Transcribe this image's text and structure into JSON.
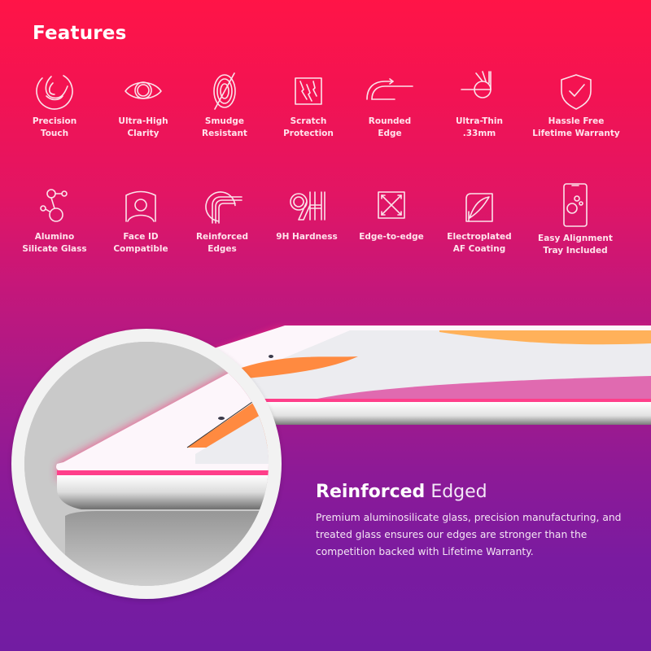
{
  "title": "Features",
  "features": [
    {
      "icon": "precision-touch-icon",
      "label": "Precision\nTouch"
    },
    {
      "icon": "eye-icon",
      "label": "Ultra-High\nClarity"
    },
    {
      "icon": "fingerprint-icon",
      "label": "Smudge\nResistant"
    },
    {
      "icon": "scratch-icon",
      "label": "Scratch\nProtection"
    },
    {
      "icon": "rounded-edge-icon",
      "label": "Rounded\nEdge"
    },
    {
      "icon": "ultra-thin-icon",
      "label": "Ultra-Thin\n.33mm"
    },
    {
      "icon": "shield-check-icon",
      "label": "Hassle Free\nLifetime Warranty"
    },
    {
      "icon": "molecule-icon",
      "label": "Alumino\nSilicate Glass"
    },
    {
      "icon": "face-id-icon",
      "label": "Face ID\nCompatible"
    },
    {
      "icon": "reinforced-edges-icon",
      "label": "Reinforced\nEdges"
    },
    {
      "icon": "9h-icon",
      "label": "9H Hardness"
    },
    {
      "icon": "edge-to-edge-icon",
      "label": "Edge-to-edge"
    },
    {
      "icon": "af-coating-icon",
      "label": "Electroplated\nAF Coating"
    },
    {
      "icon": "alignment-tray-icon",
      "label": "Easy Alignment\nTray Included"
    }
  ],
  "info": {
    "heading_bold": "Reinforced",
    "heading_light": "Edged",
    "body": "Premium aluminosilicate glass, precision manufacturing, and treated glass ensures our edges are stronger than the competition backed with Lifetime Warranty."
  },
  "colors": {
    "gradient_top": "#ff1447",
    "gradient_bottom": "#721ca2",
    "glow": "#ff2d7a"
  }
}
